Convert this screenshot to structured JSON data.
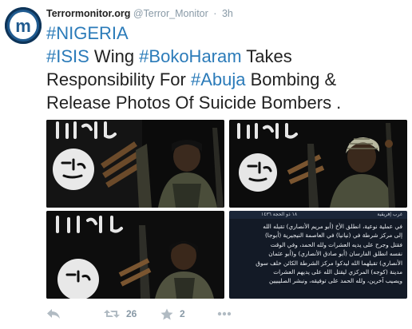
{
  "tweet": {
    "name": "Terrormonitor.org",
    "handle": "@Terror_Monitor",
    "separator": "·",
    "time": "3h",
    "avatar_letter": "m",
    "text_line1": {
      "tag1": "#NIGERIA"
    },
    "text_line2": {
      "tag1": "#ISIS",
      "t1": " Wing ",
      "tag2": "#BokoHaram",
      "t2": " Takes"
    },
    "text_line3": {
      "t1": "Responsibility For ",
      "tag1": "#Abuja",
      "t2": " Bombing &"
    },
    "text_line4": {
      "t1": "Release Photos Of Suicide Bombers ."
    }
  },
  "media": {
    "statement": {
      "title": "غرب إفريقية",
      "date": "١٨ ذو الحجة ١٤٣٦",
      "lines": [
        "في عملية نوعية، انطلق الأخ (أبو مريم الأنصاري) تقبله الله",
        "إلى مركز شرطة في (نيانيا) في العاصمة النيجيرية (أبوجا)",
        "فقتل وجرح على يديه العشرات ولله الحمد، وفي الوقت",
        "نفسه انطلق الفارسان (أبو صادق الأنصاري) و(أبو عثمان",
        "الأنصاري) تقبلهما الله ليدكوا مركز الشرطة الكائن خلف سوق",
        "مدينة (كوجه) المركزي ليقتل الله على يديهم العشرات",
        "ويصيب آخرين، ولله الحمد على توفيقه، ونبشر الصليبيين"
      ]
    }
  },
  "actions": {
    "retweets": "26",
    "favorites": "2"
  },
  "colors": {
    "hashtag": "#2b7bb9",
    "text": "#222222",
    "meta": "#8899a6",
    "avatar": "#1f5a8f"
  },
  "icons": [
    "reply-icon",
    "retweet-icon",
    "favorite-icon",
    "more-icon"
  ]
}
